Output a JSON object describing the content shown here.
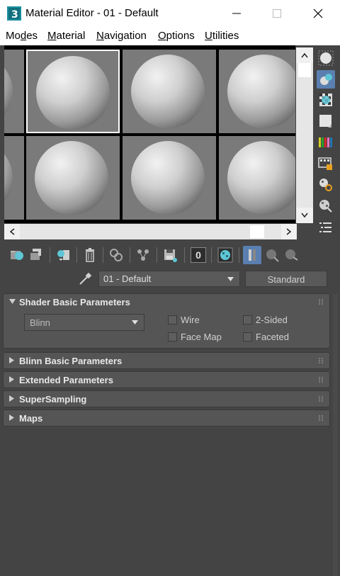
{
  "window": {
    "title": "Material Editor - 01 - Default"
  },
  "menu": {
    "items": [
      {
        "pre": "Mo",
        "mn": "d",
        "post": "es"
      },
      {
        "pre": "",
        "mn": "M",
        "post": "aterial"
      },
      {
        "pre": "",
        "mn": "N",
        "post": "avigation"
      },
      {
        "pre": "",
        "mn": "O",
        "post": "ptions"
      },
      {
        "pre": "",
        "mn": "U",
        "post": "tilities"
      }
    ]
  },
  "material": {
    "name": "01 - Default",
    "type_button": "Standard"
  },
  "rollouts": {
    "shader_basic": {
      "title": "Shader Basic Parameters",
      "shader": "Blinn",
      "wire": "Wire",
      "two_sided": "2-Sided",
      "face_map": "Face Map",
      "faceted": "Faceted"
    },
    "blinn_basic": {
      "title": "Blinn Basic Parameters"
    },
    "extended": {
      "title": "Extended Parameters"
    },
    "supersampling": {
      "title": "SuperSampling"
    },
    "maps": {
      "title": "Maps"
    }
  },
  "toolbar": {
    "material_id_channel": "0"
  },
  "colors": {
    "panel_bg": "#444444",
    "rollout_bg": "#555555",
    "active_tool": "#5a7fb0",
    "slot_bg": "#7a7a7a"
  }
}
